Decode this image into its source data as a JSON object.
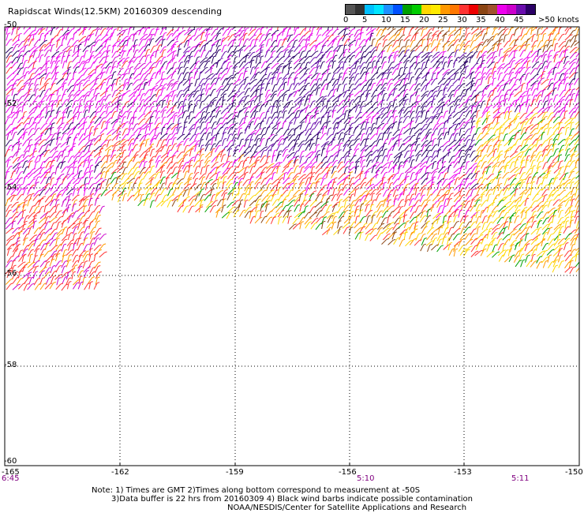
{
  "title": "Rapidscat Winds(12.5KM) 20160309 descending",
  "colorbar": {
    "colors": [
      "#555555",
      "#333333",
      "#00bfff",
      "#00e5ff",
      "#1e90ff",
      "#0050ff",
      "#00a000",
      "#00cc00",
      "#ffd700",
      "#ffea00",
      "#ff9900",
      "#ff7700",
      "#ff3333",
      "#ee0000",
      "#8b4513",
      "#a0522d",
      "#ee00ee",
      "#cc00cc",
      "#6a0dad",
      "#2b0066"
    ],
    "labels": [
      "0",
      "5",
      "10",
      "15",
      "20",
      "25",
      "30",
      "35",
      "40",
      "45",
      ">50 knots"
    ]
  },
  "lat_labels": [
    "-50",
    "-52",
    "-54",
    "-56",
    "-58",
    "-60"
  ],
  "lon_labels": [
    "-165",
    "-162",
    "-159",
    "-156",
    "-153",
    "-150"
  ],
  "time_labels": [
    "6:45",
    "5:10",
    "5:11"
  ],
  "notes": [
    "Note: 1) Times are GMT 2)Times along bottom correspond to measurement at -50S",
    "3)Data buffer is 22 hrs from 20160309 4) Black wind barbs indicate possible contamination",
    "NOAA/NESDIS/Center for Satellite Applications and Research"
  ]
}
